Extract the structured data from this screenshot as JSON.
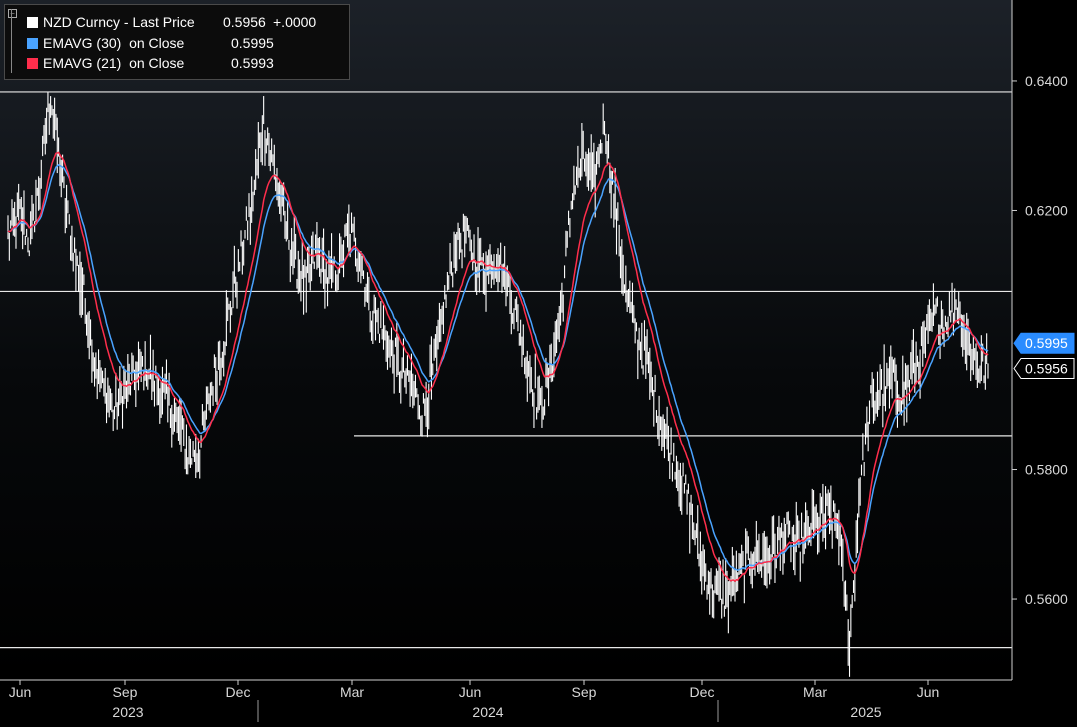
{
  "chart_data": {
    "type": "line",
    "title": "",
    "ylim": [
      0.5475,
      0.6525
    ],
    "y_ticks": [
      "0.6400",
      "0.6200",
      "0.5800",
      "0.5600"
    ],
    "x_months": [
      {
        "label": "Jun",
        "index": 0
      },
      {
        "label": "Sep",
        "index": 1
      },
      {
        "label": "Dec",
        "index": 2
      },
      {
        "label": "Mar",
        "index": 3
      },
      {
        "label": "Jun",
        "index": 4
      },
      {
        "label": "Sep",
        "index": 5
      },
      {
        "label": "Dec",
        "index": 6
      },
      {
        "label": "Mar",
        "index": 7
      },
      {
        "label": "Jun",
        "index": 8
      }
    ],
    "x_years": [
      "2023",
      "2024",
      "2025"
    ],
    "horizontal_lines": [
      {
        "name": "resistance-line-top",
        "value": 0.6383,
        "full": true
      },
      {
        "name": "resistance-line-mid",
        "value": 0.6075,
        "full": true
      },
      {
        "name": "support-line-mid",
        "value": 0.5852,
        "full": false
      },
      {
        "name": "support-line-bottom",
        "value": 0.5525,
        "full": true
      }
    ],
    "series": [
      {
        "name": "NZD Curncy - Last Price",
        "color": "#ffffff",
        "kind": "hl-bars",
        "last_value": "0.5956",
        "change": "+.0000",
        "closes": [
          0.616,
          0.62,
          0.615,
          0.624,
          0.638,
          0.625,
          0.615,
          0.608,
          0.598,
          0.592,
          0.589,
          0.592,
          0.595,
          0.596,
          0.593,
          0.59,
          0.587,
          0.582,
          0.583,
          0.592,
          0.598,
          0.606,
          0.614,
          0.622,
          0.634,
          0.626,
          0.618,
          0.612,
          0.608,
          0.614,
          0.609,
          0.611,
          0.617,
          0.613,
          0.605,
          0.602,
          0.598,
          0.595,
          0.592,
          0.589,
          0.596,
          0.606,
          0.614,
          0.616,
          0.612,
          0.611,
          0.613,
          0.608,
          0.602,
          0.595,
          0.589,
          0.596,
          0.606,
          0.623,
          0.628,
          0.624,
          0.634,
          0.62,
          0.607,
          0.601,
          0.596,
          0.589,
          0.584,
          0.58,
          0.574,
          0.566,
          0.562,
          0.56,
          0.562,
          0.565,
          0.567,
          0.566,
          0.568,
          0.57,
          0.568,
          0.57,
          0.572,
          0.573,
          0.571,
          0.553,
          0.578,
          0.59,
          0.592,
          0.594,
          0.592,
          0.595,
          0.599,
          0.604,
          0.603,
          0.606,
          0.6,
          0.596,
          0.5956
        ]
      },
      {
        "name": "EMAVG (30) on Close",
        "color": "#4aa3ff",
        "kind": "line",
        "last_value": "0.5995"
      },
      {
        "name": "EMAVG (21) on Close",
        "color": "#ff2e4c",
        "kind": "line",
        "last_value": "0.5993"
      }
    ],
    "grid": false,
    "legend_position": "top-left"
  },
  "legend": {
    "row1_label": "NZD Curncy - Last Price",
    "row1_value": "0.5956",
    "row1_change": "+.0000",
    "row2_label": "EMAVG (30)  on Close",
    "row2_value": "0.5995",
    "row3_label": "EMAVG (21)  on Close",
    "row3_value": "0.5993"
  },
  "price_tags": {
    "ema30": "0.5995",
    "last": "0.5956"
  },
  "colors": {
    "background": "#000000",
    "price": "#ffffff",
    "ema30": "#4aa3ff",
    "ema21": "#ff2e4c",
    "ema30_tag_bg": "#2a8cff",
    "axis": "#c8c8c8"
  }
}
